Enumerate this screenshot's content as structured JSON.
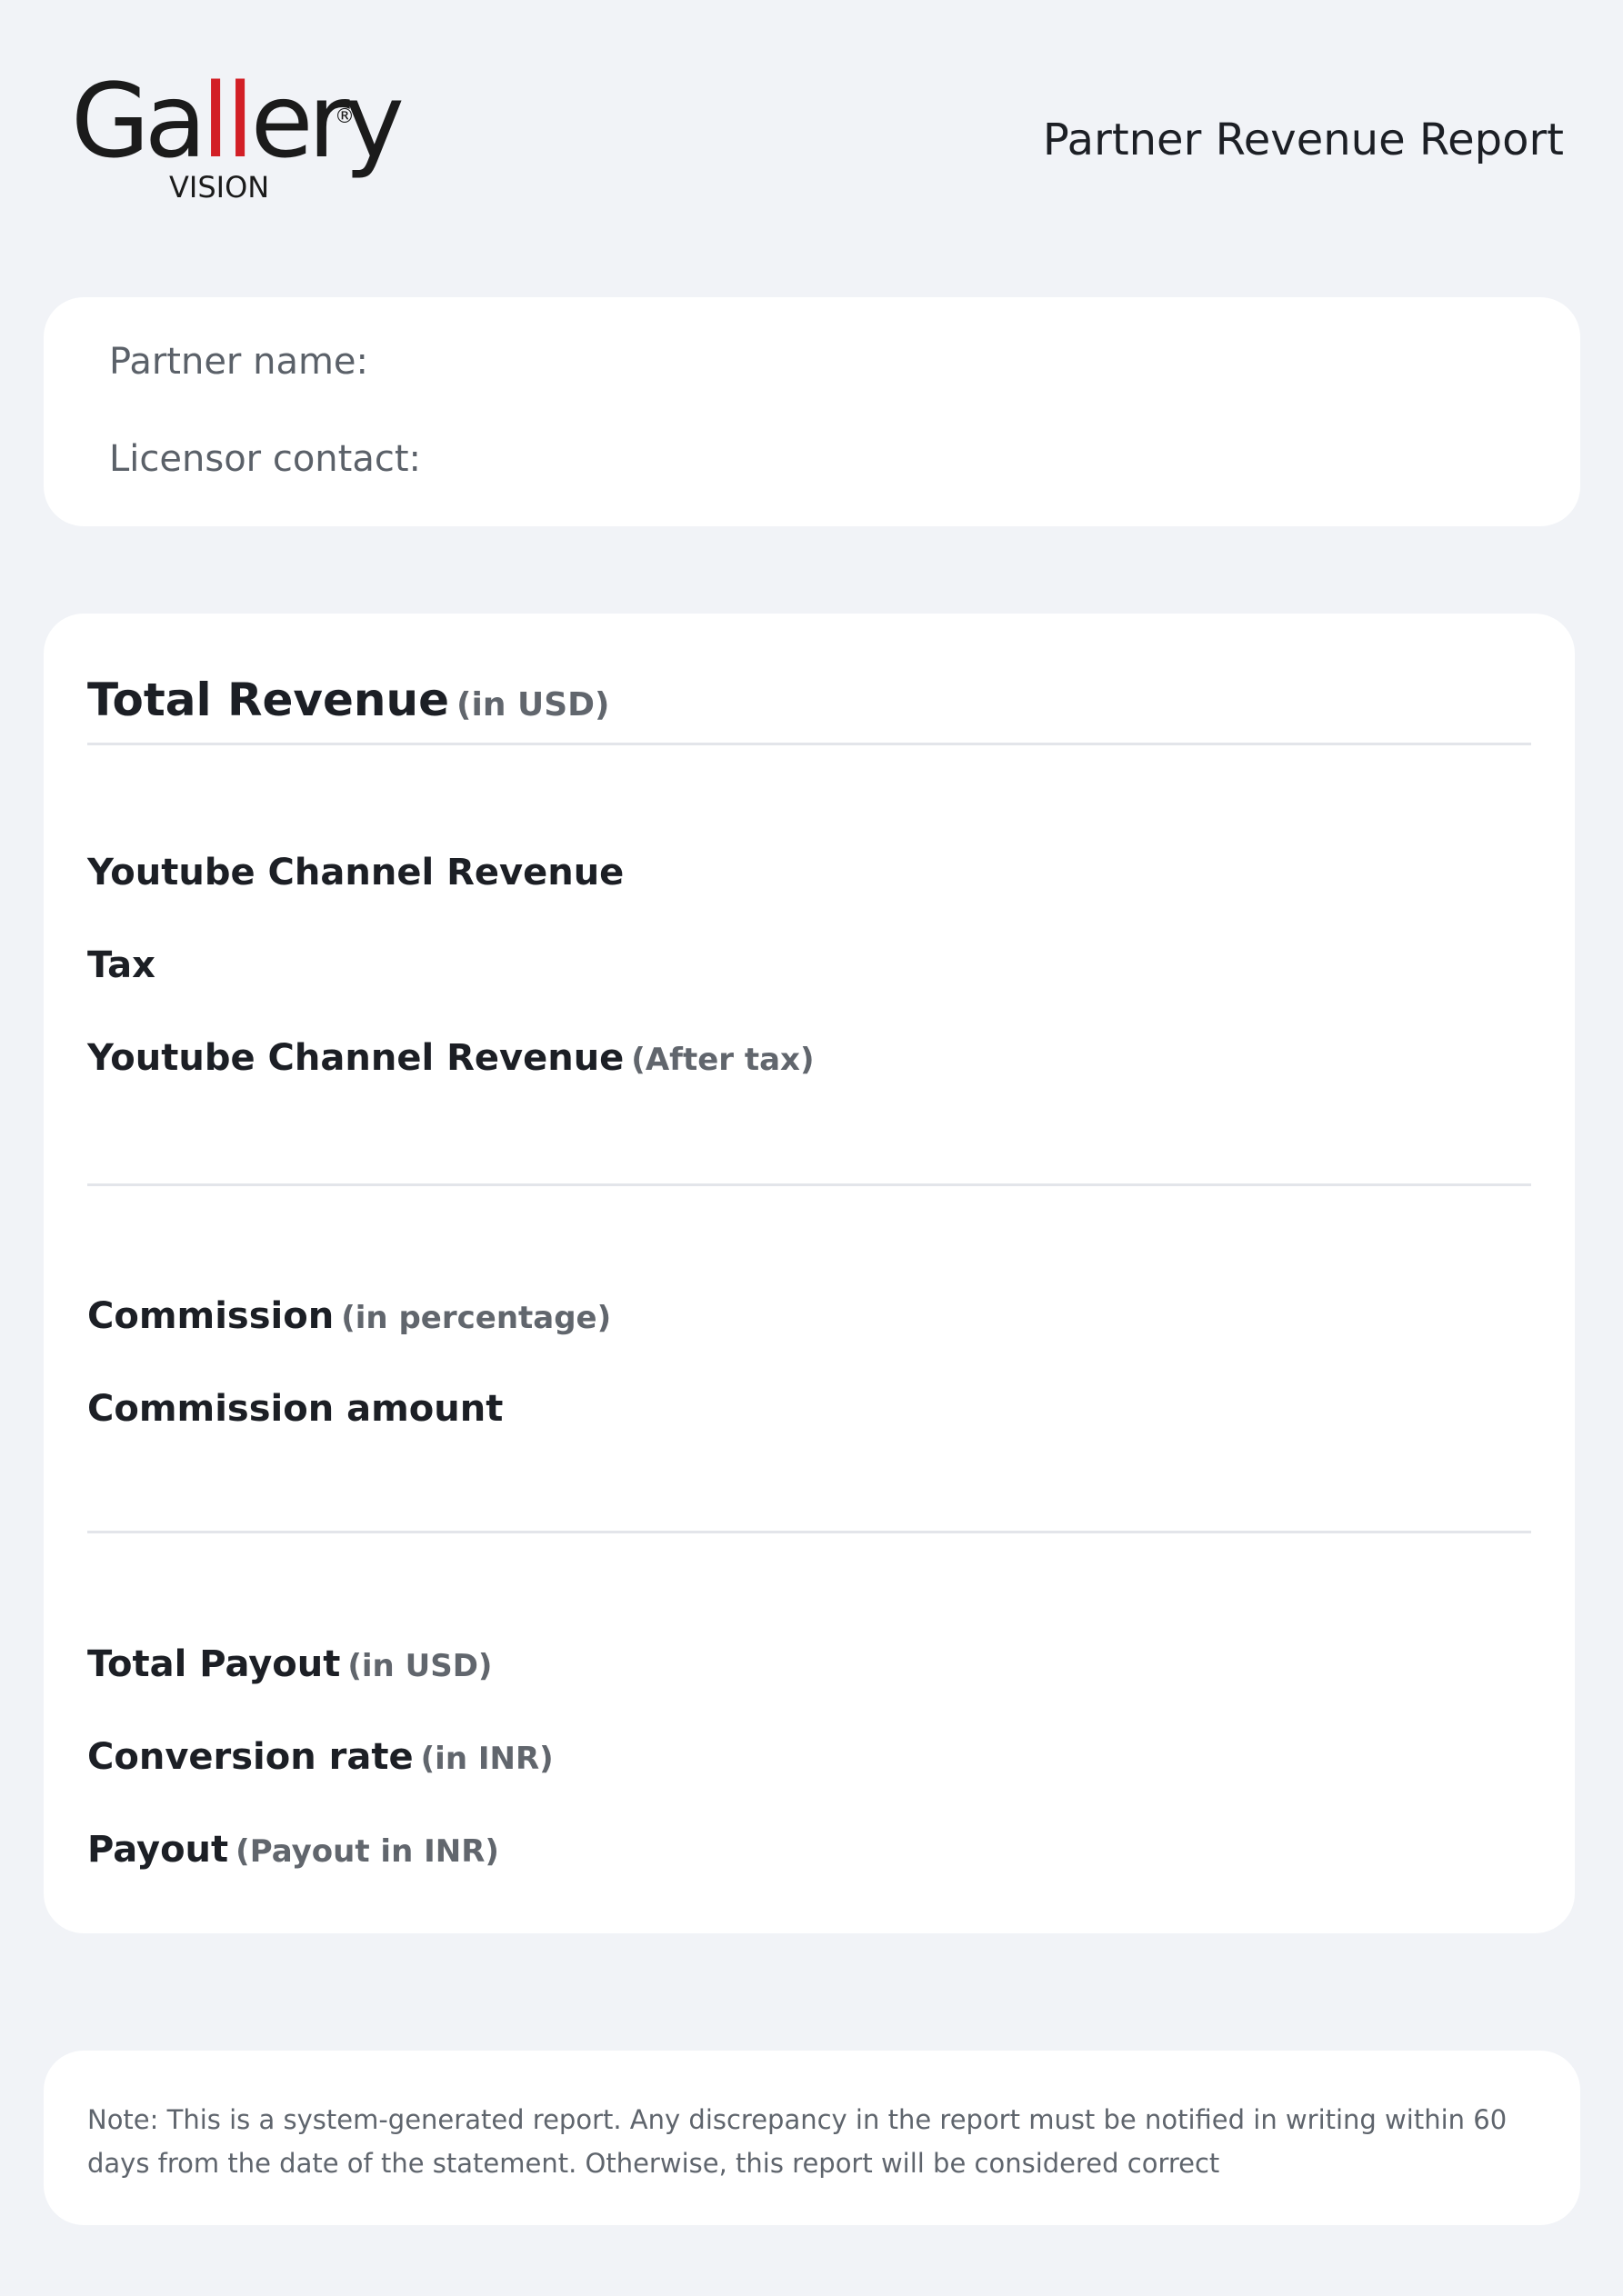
{
  "header": {
    "logo": {
      "word_g": "G",
      "word_a": "a",
      "word_ll": "ll",
      "word_ery": "ery",
      "registered": "®",
      "sub": "VISION"
    },
    "title": "Partner Revenue Report"
  },
  "partner": {
    "name_label": "Partner name:",
    "contact_label": "Licensor contact:"
  },
  "revenue": {
    "title": "Total Revenue",
    "title_unit": "(in USD)",
    "rows": [
      {
        "label": "Youtube Channel Revenue",
        "note": ""
      },
      {
        "label": "Tax",
        "note": ""
      },
      {
        "label": "Youtube Channel Revenue",
        "note": "(After tax)"
      },
      {
        "label": "Commission",
        "note": "(in percentage)"
      },
      {
        "label": "Commission amount",
        "note": ""
      },
      {
        "label": "Total Payout",
        "note": "(in USD)"
      },
      {
        "label": "Conversion rate",
        "note": "(in INR)"
      },
      {
        "label": "Payout",
        "note": "(Payout in INR)"
      }
    ]
  },
  "note": {
    "text": "Note: This is a system-generated report. Any discrepancy in the report must be notified in writing within 60 days from the date of the statement. Otherwise, this report will be considered correct"
  }
}
